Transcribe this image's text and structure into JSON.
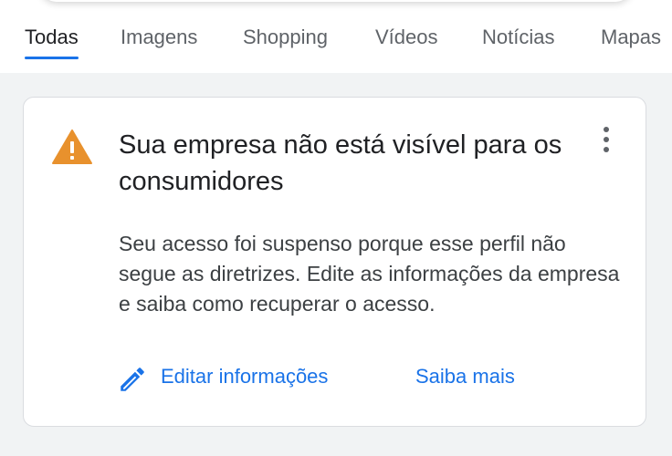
{
  "tabs": [
    {
      "label": "Todas",
      "active": true
    },
    {
      "label": "Imagens",
      "active": false
    },
    {
      "label": "Shopping",
      "active": false
    },
    {
      "label": "Vídeos",
      "active": false
    },
    {
      "label": "Notícias",
      "active": false
    },
    {
      "label": "Mapas",
      "active": false
    }
  ],
  "card": {
    "icon": "warning-icon",
    "title": "Sua empresa não está visível para os consumidores",
    "description": "Seu acesso foi suspenso porque esse perfil não segue as diretrizes. Edite as informações da empresa e saiba como recuperar o acesso.",
    "actions": {
      "edit_icon": "pencil-icon",
      "edit_label": "Editar informações",
      "learn_more_label": "Saiba mais"
    },
    "more_icon": "more-vert-icon"
  },
  "colors": {
    "accent": "#1a73e8",
    "warning": "#e8912d",
    "text_primary": "#202124",
    "text_secondary": "#5f6368"
  }
}
